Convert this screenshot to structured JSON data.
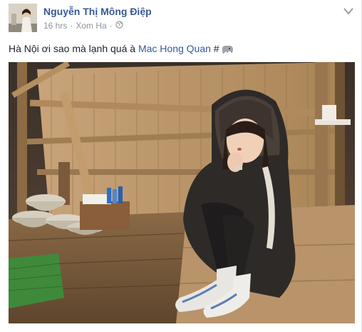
{
  "post": {
    "author": "Nguyễn Thị Mông Điệp",
    "time": "16 hrs",
    "separator": "·",
    "location": "Xom Ha",
    "privacy_icon": "globe-icon",
    "menu_icon": "chevron-down-icon",
    "text": "Hà Nội ơi sao mà lạnh quá à ",
    "mention": "Mac Hong Quan",
    "hashtag": " #",
    "emoji_icon": "elephant-emoji-icon"
  }
}
